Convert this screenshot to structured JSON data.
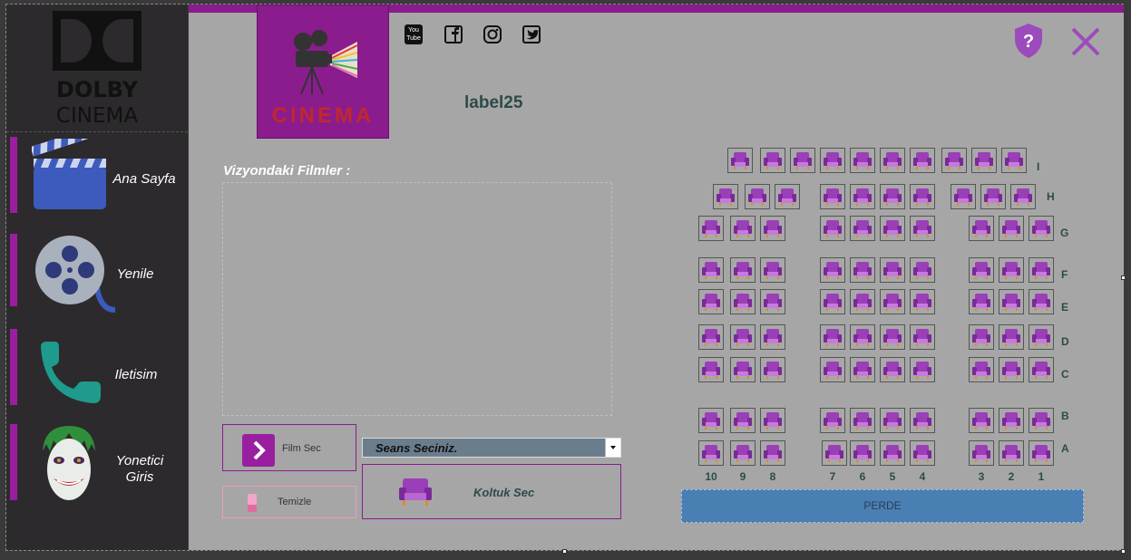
{
  "sidebar": {
    "logo": {
      "line1": "DOLBY",
      "line2": "CINEMA"
    },
    "items": [
      {
        "label": "Ana Sayfa",
        "icon": "clapperboard-icon"
      },
      {
        "label": "Yenile",
        "icon": "film-reel-icon"
      },
      {
        "label": "Iletisim",
        "icon": "phone-icon"
      },
      {
        "label": "Yonetici Giris",
        "icon": "joker-icon"
      }
    ]
  },
  "header": {
    "brand_text": "CINEMA",
    "social": [
      "youtube-icon",
      "facebook-icon",
      "instagram-icon",
      "twitter-icon"
    ],
    "youtube_text": "You Tube",
    "label25": "label25"
  },
  "films": {
    "title": "Vizyondaki Filmler :"
  },
  "buttons": {
    "film_sec": "Film Sec",
    "temizle": "Temizle",
    "koltuk_sec": "Koltuk Sec"
  },
  "seans": {
    "selected": "Seans Seciniz."
  },
  "seating": {
    "rows": [
      {
        "label": "I",
        "seats": 10
      },
      {
        "label": "H",
        "seats": 10
      },
      {
        "label": "G",
        "seats": 10
      },
      {
        "label": "F",
        "seats": 10
      },
      {
        "label": "E",
        "seats": 10
      },
      {
        "label": "D",
        "seats": 10
      },
      {
        "label": "C",
        "seats": 10
      },
      {
        "label": "B",
        "seats": 10
      },
      {
        "label": "A",
        "seats": 10
      }
    ],
    "columns": [
      "10",
      "9",
      "8",
      "7",
      "6",
      "5",
      "4",
      "3",
      "2",
      "1"
    ],
    "screen": "PERDE"
  },
  "colors": {
    "accent": "#8a1c8e",
    "seat_purple": "#9b3fb8",
    "sidebar": "#2c2a2c",
    "main": "#a6a6a6",
    "screen": "#4a7fb4"
  }
}
